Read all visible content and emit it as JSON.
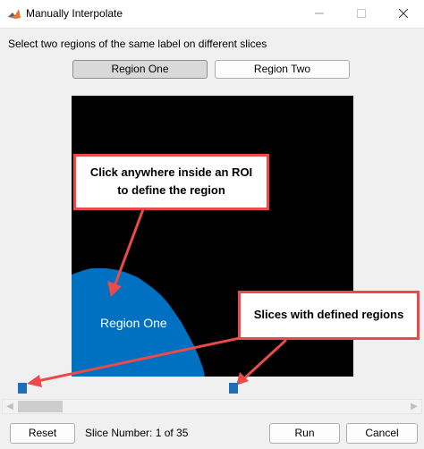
{
  "window": {
    "title": "Manually Interpolate",
    "icon": "matlab-icon"
  },
  "instruction": "Select two regions of the same label on different slices",
  "regions": {
    "one_label": "Region One",
    "two_label": "Region Two",
    "selected": "Region One"
  },
  "image": {
    "region_label": "Region One",
    "region_color": "#0070c0"
  },
  "callouts": {
    "roi_line1": "Click anywhere inside an ROI",
    "roi_line2": "to define the region",
    "slices": "Slices with defined regions"
  },
  "colors": {
    "callout_border": "#ea4a4a",
    "slice_marker": "#1f6fb8"
  },
  "slider": {
    "current_slice": 1,
    "total_slices": 35
  },
  "footer": {
    "reset_label": "Reset",
    "slice_number_text": "Slice Number: 1 of 35",
    "run_label": "Run",
    "cancel_label": "Cancel"
  }
}
